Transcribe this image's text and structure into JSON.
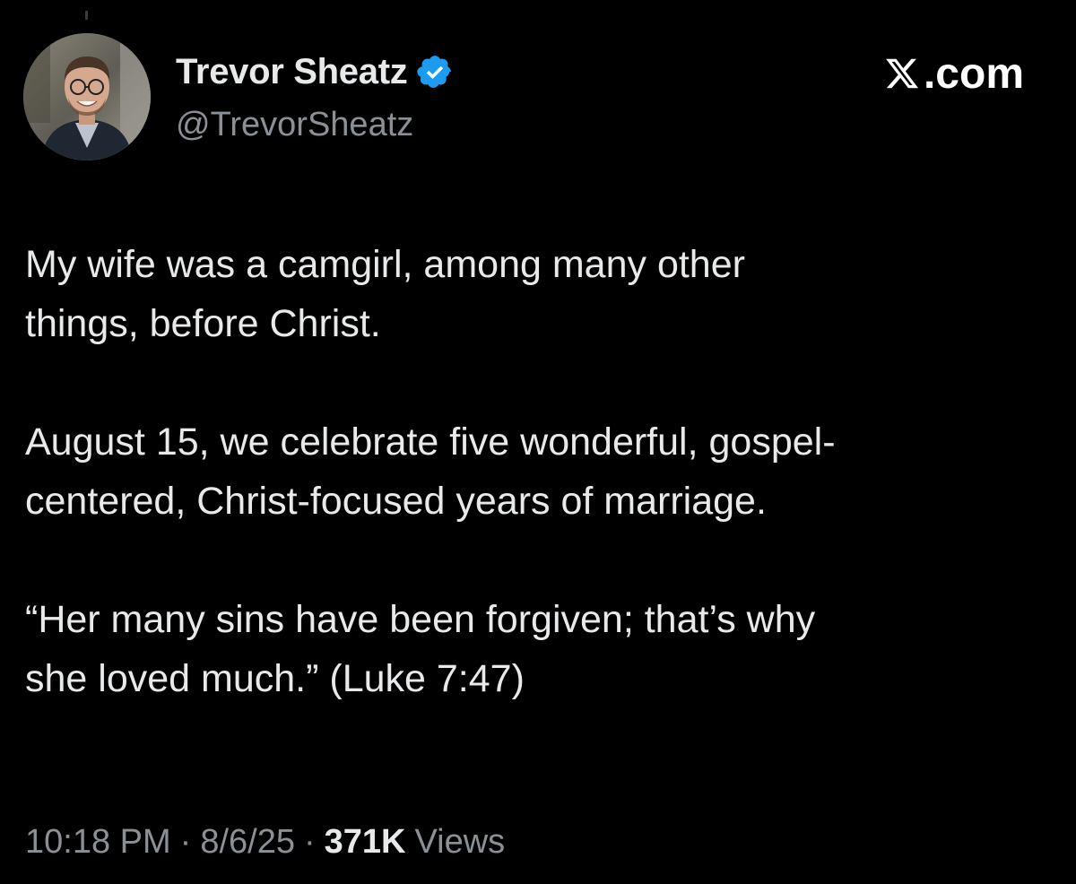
{
  "author": {
    "display_name": "Trevor Sheatz",
    "handle": "@TrevorSheatz",
    "verified": true,
    "avatar_icon": "profile-photo",
    "verified_icon": "verified-badge-icon"
  },
  "brand": {
    "label": ".com",
    "logo_icon": "x-logo-icon"
  },
  "tweet": {
    "paragraphs": [
      "My wife was a camgirl, among many other\nthings, before Christ.",
      "August 15, we celebrate five wonderful, gospel-\ncentered, Christ-focused years of marriage.",
      "“Her many sins have been forgiven; that’s why\nshe loved much.” (Luke 7:47)"
    ]
  },
  "meta": {
    "time": "10:18 PM",
    "date": "8/6/25",
    "separator": "·",
    "views_count": "371K",
    "views_label": "Views"
  },
  "colors": {
    "background": "#000000",
    "text_primary": "#e7e9ea",
    "text_secondary": "#8b9097",
    "verified_blue": "#1d9bf0"
  }
}
